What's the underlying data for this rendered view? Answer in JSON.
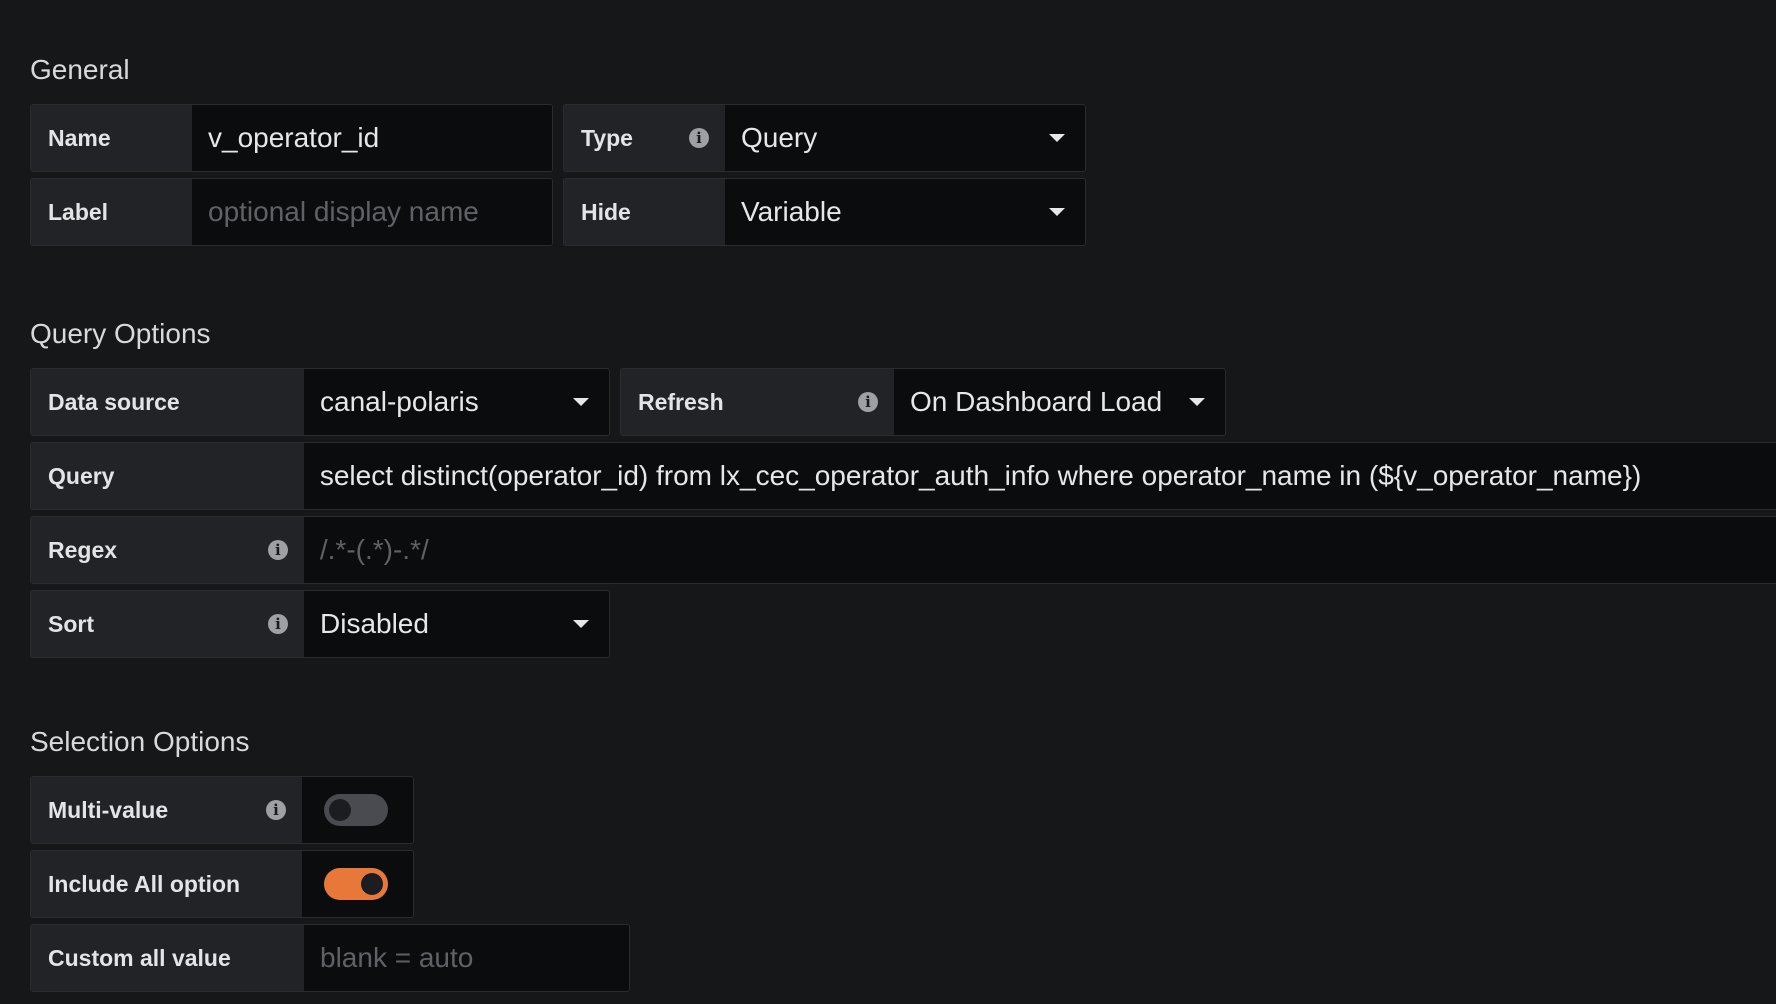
{
  "general": {
    "title": "General",
    "name": {
      "label": "Name",
      "value": "v_operator_id"
    },
    "type": {
      "label": "Type",
      "value": "Query"
    },
    "label": {
      "label": "Label",
      "placeholder": "optional display name"
    },
    "hide": {
      "label": "Hide",
      "value": "Variable"
    }
  },
  "query_options": {
    "title": "Query Options",
    "data_source": {
      "label": "Data source",
      "value": "canal-polaris"
    },
    "refresh": {
      "label": "Refresh",
      "value": "On Dashboard Load"
    },
    "query": {
      "label": "Query",
      "value": "select distinct(operator_id) from lx_cec_operator_auth_info where operator_name in (${v_operator_name})"
    },
    "regex": {
      "label": "Regex",
      "placeholder": "/.*-(.*)-.*/"
    },
    "sort": {
      "label": "Sort",
      "value": "Disabled"
    }
  },
  "selection_options": {
    "title": "Selection Options",
    "multi_value": {
      "label": "Multi-value",
      "enabled": false
    },
    "include_all": {
      "label": "Include All option",
      "enabled": true
    },
    "custom_all_value": {
      "label": "Custom all value",
      "placeholder": "blank = auto"
    }
  },
  "colors": {
    "background": "#161719",
    "label_bg": "#222327",
    "input_bg": "#0b0c0e",
    "accent_orange": "#e8783a"
  },
  "icons": {
    "info": "info-icon",
    "dropdown": "caret-down-icon"
  }
}
